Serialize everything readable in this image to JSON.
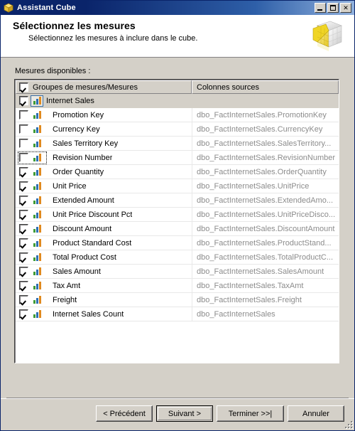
{
  "window": {
    "title": "Assistant Cube",
    "icon": "cube-icon",
    "controls": {
      "minimize": "minimize-button",
      "maximize": "maximize-button",
      "close_label": "✕"
    }
  },
  "header": {
    "title": "Sélectionnez les mesures",
    "subtitle": "Sélectionnez les mesures à inclure dans le cube.",
    "icon": "cube-illustration"
  },
  "main": {
    "field_label": "Mesures disponibles :",
    "columns": [
      {
        "label": "Groupes de mesures/Mesures",
        "checkbox": true,
        "checked": true
      },
      {
        "label": "Colonnes sources",
        "checkbox": false,
        "checked": false
      }
    ],
    "rows": [
      {
        "label": "Internet Sales",
        "source": "",
        "checked": true,
        "group": true,
        "focused": false
      },
      {
        "label": "Promotion Key",
        "source": "dbo_FactInternetSales.PromotionKey",
        "checked": false,
        "group": false,
        "focused": false
      },
      {
        "label": "Currency Key",
        "source": "dbo_FactInternetSales.CurrencyKey",
        "checked": false,
        "group": false,
        "focused": false
      },
      {
        "label": "Sales Territory Key",
        "source": "dbo_FactInternetSales.SalesTerritory...",
        "checked": false,
        "group": false,
        "focused": false
      },
      {
        "label": "Revision Number",
        "source": "dbo_FactInternetSales.RevisionNumber",
        "checked": false,
        "group": false,
        "focused": true
      },
      {
        "label": "Order Quantity",
        "source": "dbo_FactInternetSales.OrderQuantity",
        "checked": true,
        "group": false,
        "focused": false
      },
      {
        "label": "Unit Price",
        "source": "dbo_FactInternetSales.UnitPrice",
        "checked": true,
        "group": false,
        "focused": false
      },
      {
        "label": "Extended Amount",
        "source": "dbo_FactInternetSales.ExtendedAmo...",
        "checked": true,
        "group": false,
        "focused": false
      },
      {
        "label": "Unit Price Discount Pct",
        "source": "dbo_FactInternetSales.UnitPriceDisco...",
        "checked": true,
        "group": false,
        "focused": false
      },
      {
        "label": "Discount Amount",
        "source": "dbo_FactInternetSales.DiscountAmount",
        "checked": true,
        "group": false,
        "focused": false
      },
      {
        "label": "Product Standard Cost",
        "source": "dbo_FactInternetSales.ProductStand...",
        "checked": true,
        "group": false,
        "focused": false
      },
      {
        "label": "Total Product Cost",
        "source": "dbo_FactInternetSales.TotalProductC...",
        "checked": true,
        "group": false,
        "focused": false
      },
      {
        "label": "Sales Amount",
        "source": "dbo_FactInternetSales.SalesAmount",
        "checked": true,
        "group": false,
        "focused": false
      },
      {
        "label": "Tax Amt",
        "source": "dbo_FactInternetSales.TaxAmt",
        "checked": true,
        "group": false,
        "focused": false
      },
      {
        "label": "Freight",
        "source": "dbo_FactInternetSales.Freight",
        "checked": true,
        "group": false,
        "focused": false
      },
      {
        "label": "Internet Sales Count",
        "source": "dbo_FactInternetSales",
        "checked": true,
        "group": false,
        "focused": false
      }
    ]
  },
  "buttons": {
    "back": "< Précédent",
    "next": "Suivant >",
    "finish": "Terminer >>|",
    "cancel": "Annuler"
  },
  "colors": {
    "titlebar_start": "#0a246a",
    "titlebar_end": "#8fb0dd",
    "window_face": "#d4d0c8",
    "source_text": "#8c8c8c",
    "icon_green": "#3f9c35",
    "icon_blue": "#2d6fb5",
    "icon_orange": "#e08a1e",
    "cube_yellow": "#f2e05a"
  }
}
